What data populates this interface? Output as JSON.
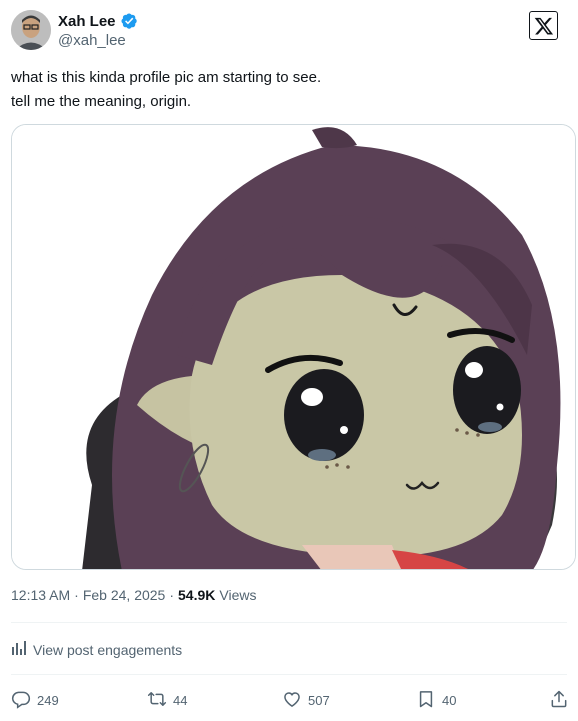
{
  "author": {
    "display_name": "Xah Lee",
    "handle": "@xah_lee",
    "verified": true
  },
  "post": {
    "text_lines": [
      "what is this kinda profile pic am starting to see.",
      "tell me the meaning, origin."
    ],
    "media": {
      "kind": "image",
      "subject": "chibi anime-style illustration of a character with dark purple hair, a crescent mark on the forehead and a safety pin in the ear"
    },
    "time": "12:13 AM",
    "separator": "·",
    "date": "Feb 24, 2025",
    "views_count": "54.9K",
    "views_label": "Views"
  },
  "engagements_link": "View post engagements",
  "actions": {
    "replies": "249",
    "reposts": "44",
    "likes": "507",
    "bookmarks": "40"
  },
  "icons": {
    "verified": "verified-badge-icon",
    "logo": "x-logo-icon",
    "engagements": "bar-chart-icon",
    "reply": "reply-icon",
    "repost": "repost-icon",
    "like": "heart-icon",
    "bookmark": "bookmark-icon",
    "share": "share-icon"
  },
  "colors": {
    "verified_blue": "#1d9bf0",
    "text_primary": "#0f1419",
    "text_secondary": "#536471",
    "border": "#cfd9de"
  }
}
